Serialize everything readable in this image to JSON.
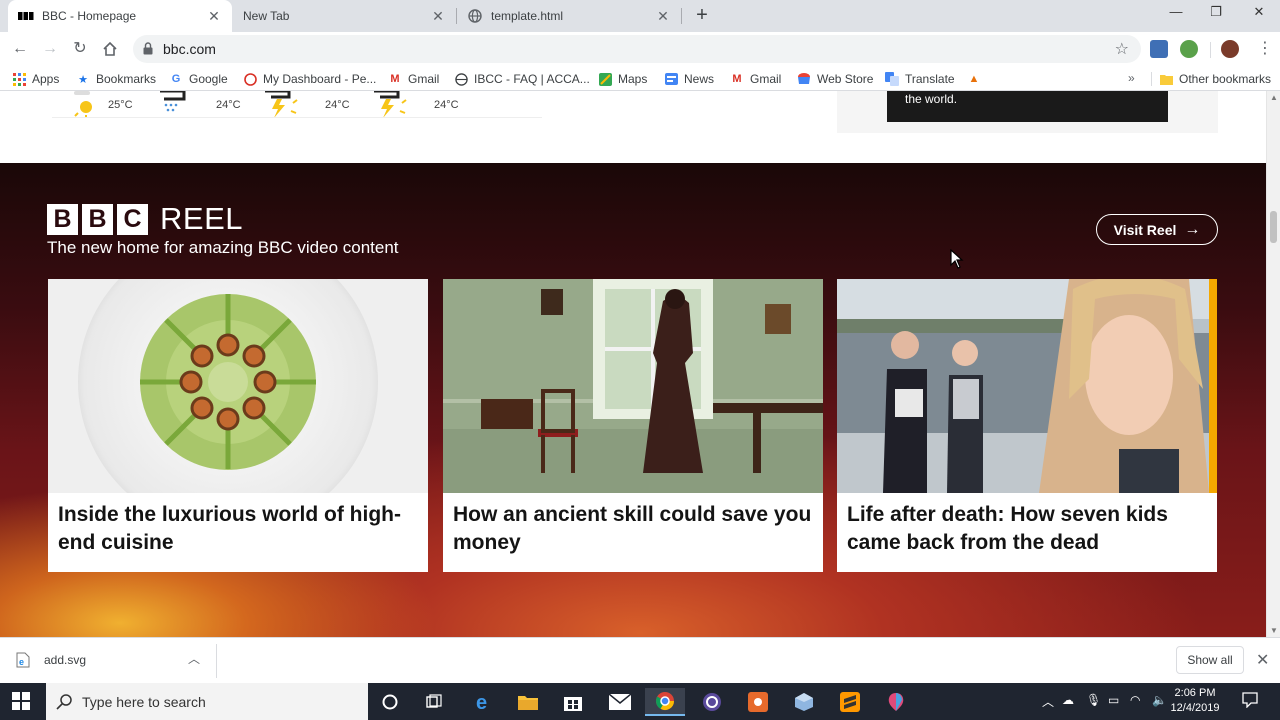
{
  "browser": {
    "tabs": [
      {
        "title": "BBC - Homepage",
        "favicon": "bbc-favicon",
        "active": true
      },
      {
        "title": "New Tab",
        "favicon": "",
        "active": false
      },
      {
        "title": "template.html",
        "favicon": "globe-icon",
        "active": false
      }
    ],
    "url": "bbc.com",
    "bookmarks": [
      {
        "label": "Apps",
        "icon": "apps-grid-icon"
      },
      {
        "label": "Bookmarks",
        "icon": "star-icon"
      },
      {
        "label": "Google",
        "icon": "google-icon"
      },
      {
        "label": "My Dashboard - Pe...",
        "icon": "dashboard-icon"
      },
      {
        "label": "Gmail",
        "icon": "gmail-icon"
      },
      {
        "label": "IBCC - FAQ | ACCA...",
        "icon": "globe-icon"
      },
      {
        "label": "Maps",
        "icon": "maps-icon"
      },
      {
        "label": "News",
        "icon": "news-icon"
      },
      {
        "label": "Gmail",
        "icon": "gmail-icon"
      },
      {
        "label": "Web Store",
        "icon": "webstore-icon"
      },
      {
        "label": "Translate",
        "icon": "translate-icon"
      },
      {
        "label": "",
        "icon": "flame-icon"
      }
    ],
    "bookmarks_more": "»",
    "other_bookmarks": "Other bookmarks"
  },
  "weather": {
    "days": [
      {
        "temp": "25°C",
        "icon": "sun-cloud-icon"
      },
      {
        "temp": "24°C",
        "icon": "rain-cloud-icon"
      },
      {
        "temp": "24°C",
        "icon": "thunder-sun-icon"
      },
      {
        "temp": "24°C",
        "icon": "thunder-sun-icon"
      }
    ]
  },
  "promo": {
    "text": "the world."
  },
  "reel": {
    "logo_letters": [
      "B",
      "B",
      "C"
    ],
    "logo_word": "REEL",
    "tagline": "The new home for amazing BBC video content",
    "visit_label": "Visit Reel",
    "cards": [
      {
        "headline": "Inside the luxurious world of high-end cuisine"
      },
      {
        "headline": "How an ancient skill could save you money"
      },
      {
        "headline": "Life after death: How seven kids came back from the dead"
      }
    ]
  },
  "downloads": {
    "file": "add.svg",
    "show_all": "Show all"
  },
  "taskbar": {
    "search_placeholder": "Type here to search",
    "time": "2:06 PM",
    "date": "12/4/2019"
  },
  "colors": {
    "reel_dark": "#2a0a0e",
    "reel_warm": "#d8602a",
    "accent_yellow": "#f5a800",
    "taskbar": "#1f2530"
  }
}
